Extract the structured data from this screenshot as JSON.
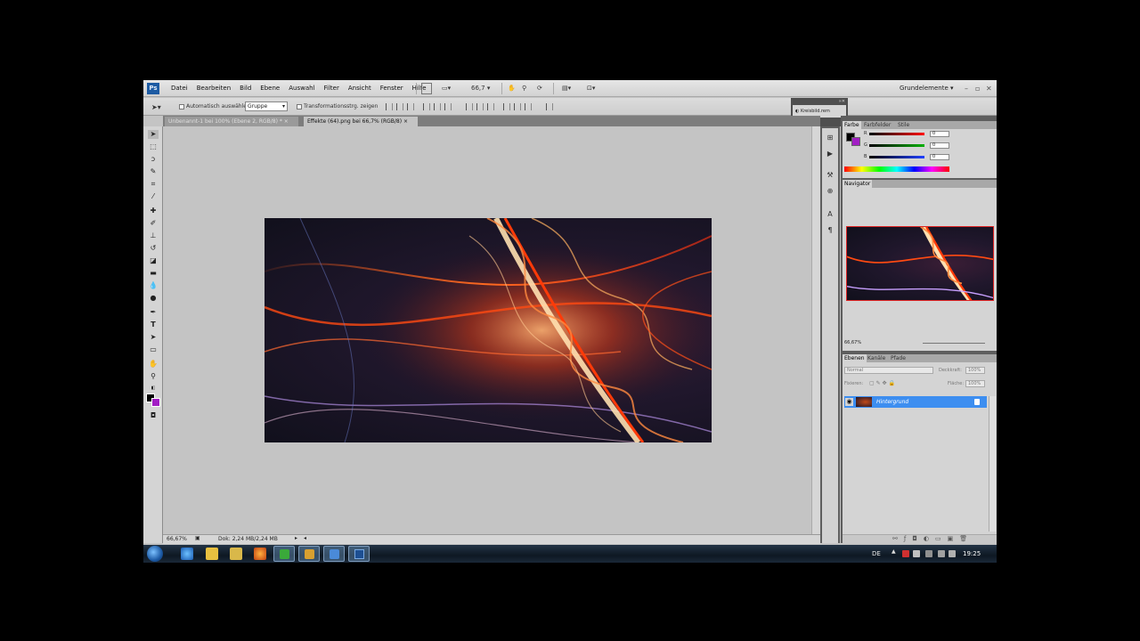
{
  "menubar": {
    "logo": "Ps",
    "items": [
      "Datei",
      "Bearbeiten",
      "Bild",
      "Ebene",
      "Auswahl",
      "Filter",
      "Ansicht",
      "Fenster",
      "Hilfe"
    ],
    "zoom": "66,7",
    "workspace": "Grundelemente"
  },
  "options": {
    "auto_select_label": "Automatisch auswählen:",
    "auto_select_value": "Gruppe",
    "transform_label": "Transformationsstrg. zeigen"
  },
  "tabs": [
    {
      "label": "Unbenannt-1 bei 100% (Ebene 2, RGB/8) *"
    },
    {
      "label": "Effekte (64).png bei 66,7% (RGB/8)"
    }
  ],
  "status": {
    "zoom": "66,67%",
    "doc": "Dok: 2,24 MB/2,24 MB"
  },
  "kurzinfo": {
    "label": "Kreisbild.rem"
  },
  "color_panel": {
    "tabs": [
      "Farbe",
      "Farbfelder",
      "Stile"
    ],
    "channels": [
      {
        "name": "R",
        "value": "0",
        "color": "#d02020"
      },
      {
        "name": "G",
        "value": "0",
        "color": "#20a020"
      },
      {
        "name": "B",
        "value": "0",
        "color": "#2040d0"
      }
    ],
    "foreground": "#000000",
    "background": "#a21ec4"
  },
  "navigator": {
    "tab": "Navigator",
    "zoom": "66,67%"
  },
  "layers_panel": {
    "tabs": [
      "Ebenen",
      "Kanäle",
      "Pfade"
    ],
    "blend_mode": "Normal",
    "opacity_label": "Deckkraft:",
    "opacity": "100%",
    "lock_label": "Fixieren:",
    "fill_label": "Fläche:",
    "fill": "100%",
    "layers": [
      {
        "name": "Hintergrund",
        "visible": true,
        "locked": true
      }
    ]
  },
  "taskbar": {
    "lang": "DE",
    "clock": "19:25"
  },
  "colors": {
    "accent": "#3d8ef0",
    "nav_frame": "#dd2222"
  }
}
